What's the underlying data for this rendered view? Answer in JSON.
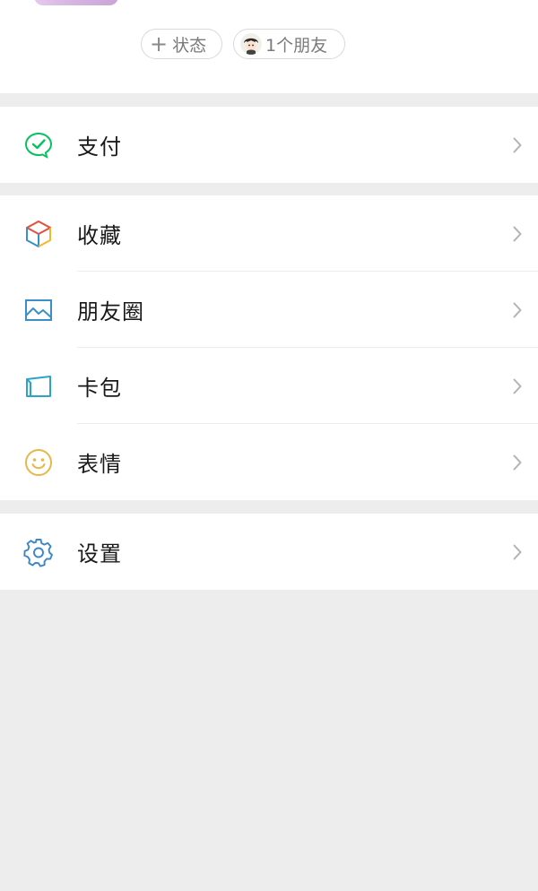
{
  "profile": {
    "status_button": {
      "icon": "plus-icon",
      "label": "状态"
    },
    "friends_button": {
      "icon": "friend-avatar",
      "label": "1个朋友"
    }
  },
  "menu": {
    "pay": {
      "icon": "wechat-pay-icon",
      "label": "支付",
      "icon_color": "#07c160"
    },
    "favorites": {
      "icon": "favorites-cube-icon",
      "label": "收藏"
    },
    "moments": {
      "icon": "moments-picture-icon",
      "label": "朋友圈",
      "icon_color": "#3a8fc8"
    },
    "cards": {
      "icon": "card-wallet-icon",
      "label": "卡包",
      "icon_color": "#2aa4c8"
    },
    "stickers": {
      "icon": "smiley-face-icon",
      "label": "表情",
      "icon_color": "#e6b84a"
    },
    "settings": {
      "icon": "gear-icon",
      "label": "设置",
      "icon_color": "#3a86c9"
    }
  },
  "colors": {
    "background": "#ededed",
    "surface": "#ffffff",
    "chevron": "#b2b2b2"
  }
}
